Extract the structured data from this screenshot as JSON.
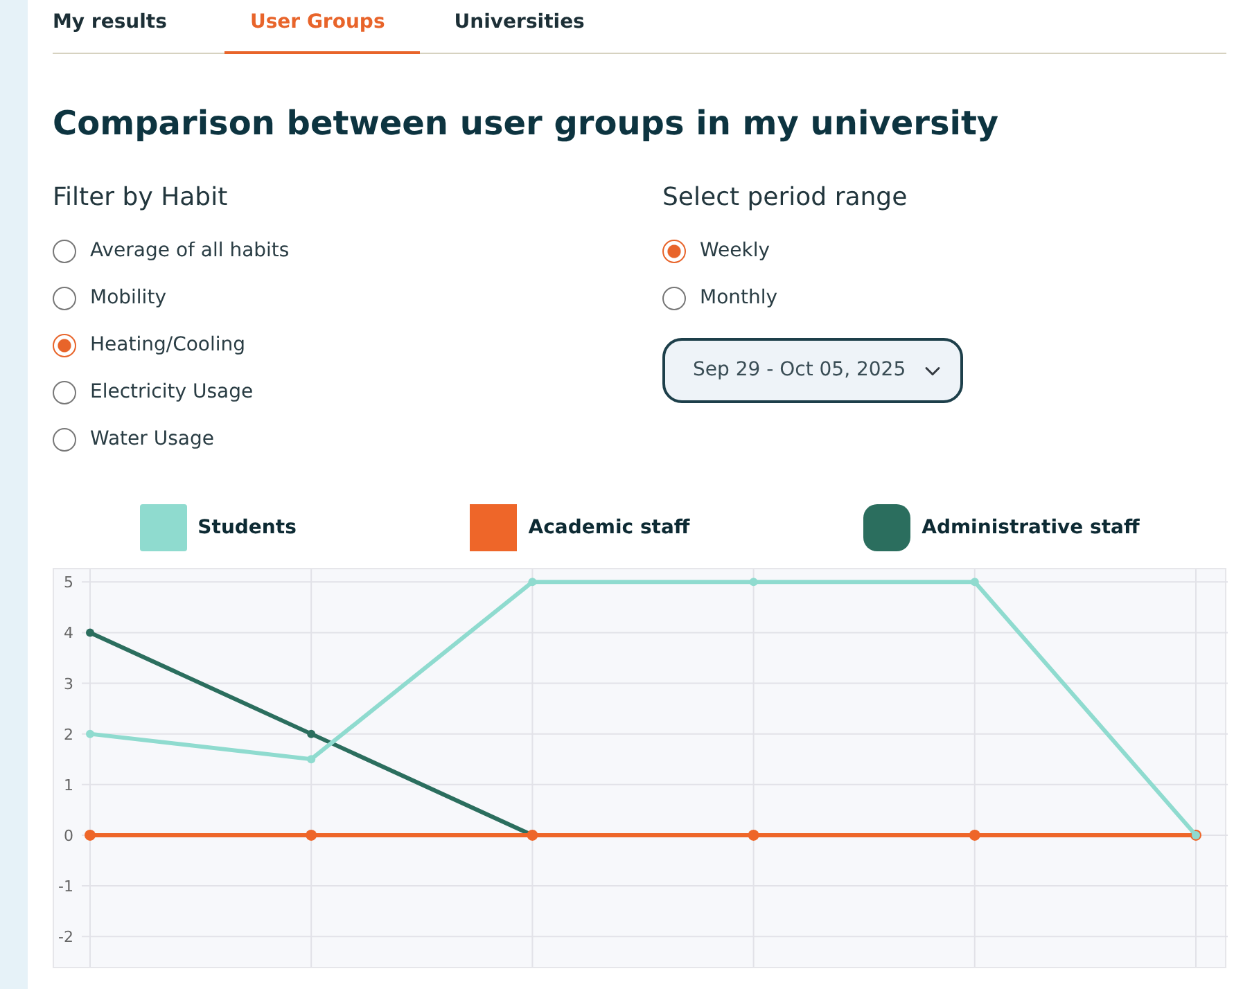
{
  "tabs": [
    {
      "label": "My results",
      "selected": false
    },
    {
      "label": "User Groups",
      "selected": true
    },
    {
      "label": "Universities",
      "selected": false
    }
  ],
  "title": "Comparison between user groups in my university",
  "habit_filter": {
    "heading": "Filter by Habit",
    "options": [
      {
        "label": "Average of all habits",
        "selected": false
      },
      {
        "label": "Mobility",
        "selected": false
      },
      {
        "label": "Heating/Cooling",
        "selected": true
      },
      {
        "label": "Electricity Usage",
        "selected": false
      },
      {
        "label": "Water Usage",
        "selected": false
      }
    ]
  },
  "period": {
    "heading": "Select period range",
    "options": [
      {
        "label": "Weekly",
        "selected": true
      },
      {
        "label": "Monthly",
        "selected": false
      }
    ],
    "range": "Sep 29 - Oct 05, 2025"
  },
  "chart": {
    "chart_data": {
      "type": "line",
      "grid": true,
      "ylim": [
        -2.6,
        5.25
      ],
      "yticks": [
        5,
        4,
        3,
        2,
        1,
        0,
        -1,
        -2
      ],
      "series": [
        {
          "name": "Students",
          "color": "#8fdbcf",
          "marker": "circle",
          "values": [
            2,
            1.5,
            5,
            5,
            5,
            0
          ]
        },
        {
          "name": "Academic staff",
          "color": "#ee6629",
          "marker": "circle",
          "values": [
            0,
            0,
            0,
            0,
            0,
            0
          ]
        },
        {
          "name": "Administrative staff",
          "color": "#2b6e5e",
          "marker": "circle",
          "values": [
            4,
            2,
            0,
            null,
            null,
            null
          ]
        }
      ]
    }
  }
}
